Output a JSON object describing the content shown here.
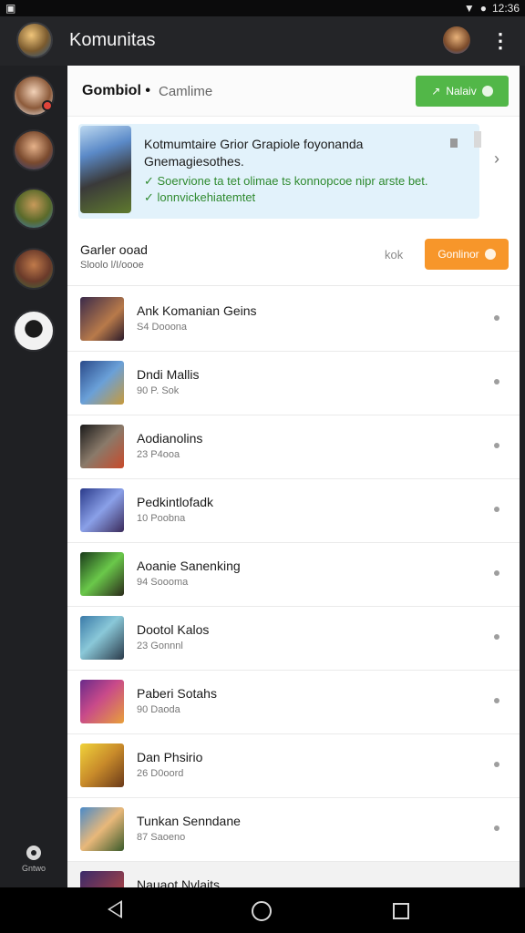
{
  "status_bar": {
    "time": "12:36"
  },
  "app_bar": {
    "title": "Komunitas"
  },
  "toolbar": {
    "heading": "Gombiol •",
    "sub": "Camlime",
    "action_label": "Nalaiv"
  },
  "banner": {
    "line1": "Kotmumtaire Grior Grapiole foyonanda",
    "line2": "Gnemagiesothes.",
    "line3": "✓ Soervione ta tet olimae ts konnopcoe nipr arste bet.",
    "line4": "✓ lonnvickehiatemtet"
  },
  "section": {
    "title": "Garler ooad",
    "sub": "Sloolo l/I/oooe",
    "ok": "kok",
    "button_label": "Gonlinor"
  },
  "list": [
    {
      "name": "Ank Komanian Geins",
      "meta": "S4 Dooona"
    },
    {
      "name": "Dndi Mallis",
      "meta": "90 P. Sok"
    },
    {
      "name": "Aodianolins",
      "meta": "23 P4ooa"
    },
    {
      "name": "Pedkintlofadk",
      "meta": "10 Poobna"
    },
    {
      "name": "Aoanie Sanenking",
      "meta": "94 Soooma"
    },
    {
      "name": "Dootol Kalos",
      "meta": "23 Gonnnl"
    },
    {
      "name": "Paberi Sotahs",
      "meta": "90 Daoda"
    },
    {
      "name": "Dan Phsirio",
      "meta": "26 D0oord"
    },
    {
      "name": "Tunkan Senndane",
      "meta": "87 Saoeno"
    },
    {
      "name": "Nauaot Nvlaits",
      "meta": ""
    }
  ],
  "sidebar": {
    "bottom_label": "Gntwo"
  },
  "colors": {
    "accent_green": "#52b748",
    "accent_orange": "#f7962a"
  }
}
